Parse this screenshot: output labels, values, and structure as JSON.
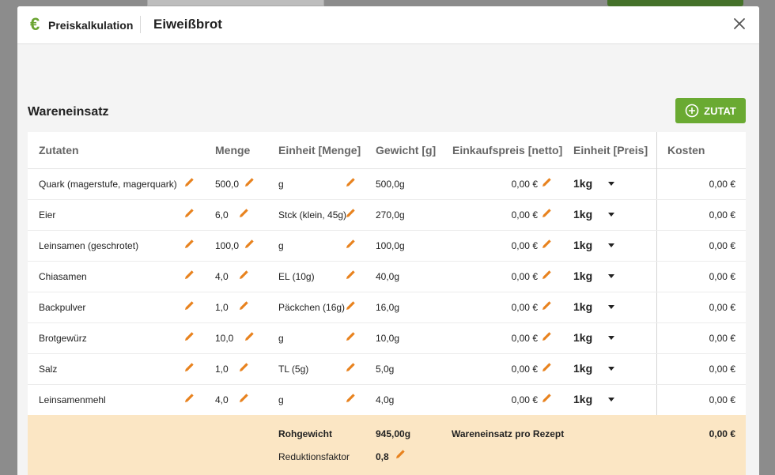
{
  "header": {
    "kicker": "Preiskalkulation",
    "title": "Eiweißbrot",
    "currency_icon": "€"
  },
  "section": {
    "title": "Wareneinsatz",
    "add_label": "ZUTAT"
  },
  "columns": [
    "Zutaten",
    "Menge",
    "Einheit [Menge]",
    "Gewicht [g]",
    "Einkaufspreis [netto]",
    "Einheit [Preis]",
    "Kosten"
  ],
  "rows": [
    {
      "name": "Quark (magerstufe, magerquark)",
      "menge": "500,0",
      "einheit": "g",
      "gewicht": "500,0g",
      "preis": "0,00 €",
      "preis_einheit": "1kg",
      "kosten": "0,00 €"
    },
    {
      "name": "Eier",
      "menge": "6,0",
      "einheit": "Stck (klein, 45g)",
      "gewicht": "270,0g",
      "preis": "0,00 €",
      "preis_einheit": "1kg",
      "kosten": "0,00 €"
    },
    {
      "name": "Leinsamen (geschrotet)",
      "menge": "100,0",
      "einheit": "g",
      "gewicht": "100,0g",
      "preis": "0,00 €",
      "preis_einheit": "1kg",
      "kosten": "0,00 €"
    },
    {
      "name": "Chiasamen",
      "menge": "4,0",
      "einheit": "EL (10g)",
      "gewicht": "40,0g",
      "preis": "0,00 €",
      "preis_einheit": "1kg",
      "kosten": "0,00 €"
    },
    {
      "name": "Backpulver",
      "menge": "1,0",
      "einheit": "Päckchen (16g)",
      "gewicht": "16,0g",
      "preis": "0,00 €",
      "preis_einheit": "1kg",
      "kosten": "0,00 €"
    },
    {
      "name": "Brotgewürz",
      "menge": "10,0",
      "einheit": "g",
      "gewicht": "10,0g",
      "preis": "0,00 €",
      "preis_einheit": "1kg",
      "kosten": "0,00 €"
    },
    {
      "name": "Salz",
      "menge": "1,0",
      "einheit": "TL (5g)",
      "gewicht": "5,0g",
      "preis": "0,00 €",
      "preis_einheit": "1kg",
      "kosten": "0,00 €"
    },
    {
      "name": "Leinsamenmehl",
      "menge": "4,0",
      "einheit": "g",
      "gewicht": "4,0g",
      "preis": "0,00 €",
      "preis_einheit": "1kg",
      "kosten": "0,00 €"
    }
  ],
  "footer": {
    "rohgewicht_label": "Rohgewicht",
    "rohgewicht_value": "945,00g",
    "wareneinsatz_label": "Wareneinsatz pro Rezept",
    "wareneinsatz_value": "0,00 €",
    "reduktion_label": "Reduktionsfaktor",
    "reduktion_value": "0,8"
  },
  "colors": {
    "accent_green": "#6aaa32",
    "pencil_orange": "#e8821e",
    "footer_bg": "#fbe6c4"
  }
}
